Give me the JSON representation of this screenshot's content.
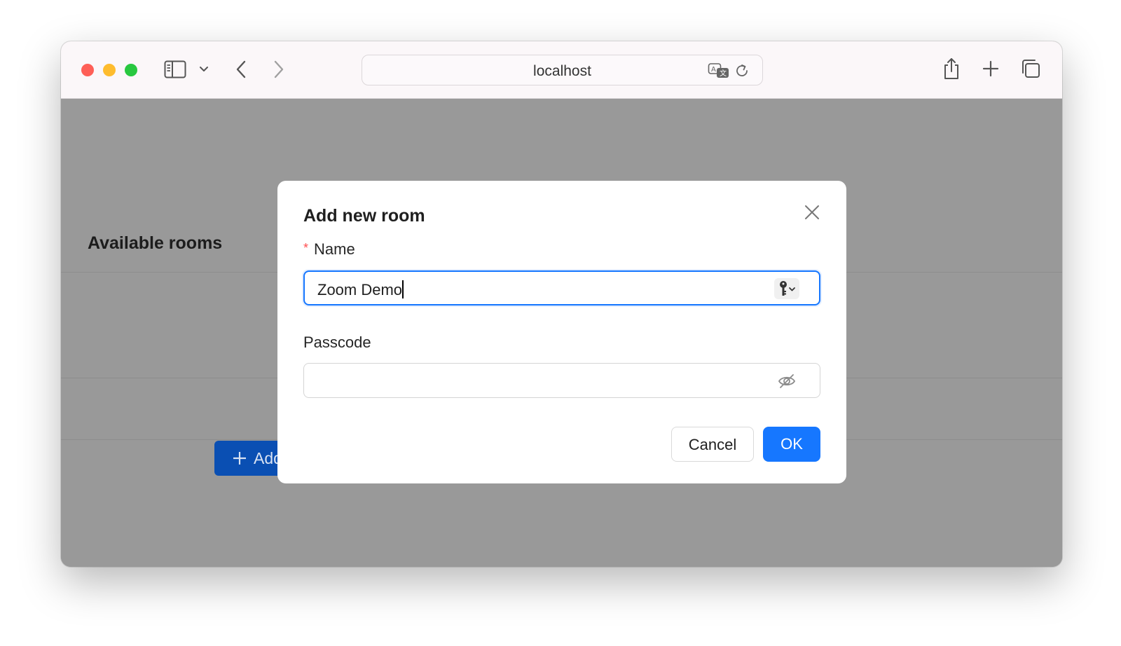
{
  "browser": {
    "address": "localhost",
    "colors": {
      "close": "#fe5f57",
      "minimize": "#febc2e",
      "zoom": "#28c840"
    }
  },
  "page": {
    "rooms_title": "Available rooms",
    "add_room_button": "Add",
    "add_room_icon": "plus-icon"
  },
  "modal": {
    "title": "Add new room",
    "required_mark": "*",
    "name_label": "Name",
    "name_value": "Zoom Demo",
    "passcode_label": "Passcode",
    "passcode_value": "",
    "cancel_label": "Cancel",
    "ok_label": "OK",
    "accent": "#1677ff"
  }
}
